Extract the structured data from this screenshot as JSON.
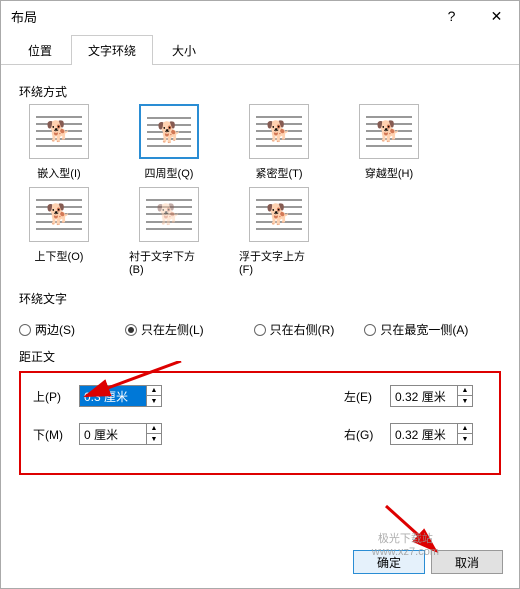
{
  "title": "布局",
  "tabs": {
    "position": "位置",
    "wrap": "文字环绕",
    "size": "大小"
  },
  "groups": {
    "wrapStyle": "环绕方式",
    "wrapText": "环绕文字",
    "distance": "距正文"
  },
  "wrapStyles": {
    "inline": "嵌入型(I)",
    "square": "四周型(Q)",
    "tight": "紧密型(T)",
    "through": "穿越型(H)",
    "topbottom": "上下型(O)",
    "behind": "衬于文字下方(B)",
    "front": "浮于文字上方(F)"
  },
  "wrapText": {
    "both": "两边(S)",
    "left": "只在左侧(L)",
    "right": "只在右侧(R)",
    "largest": "只在最宽一侧(A)"
  },
  "distance": {
    "topLabel": "上(P)",
    "bottomLabel": "下(M)",
    "leftLabel": "左(E)",
    "rightLabel": "右(G)",
    "topVal": "0.3 厘米",
    "bottomVal": "0 厘米",
    "leftVal": "0.32 厘米",
    "rightVal": "0.32 厘米"
  },
  "buttons": {
    "ok": "确定",
    "cancel": "取消"
  },
  "watermark": "极光下载站\nwww.xz7.com"
}
